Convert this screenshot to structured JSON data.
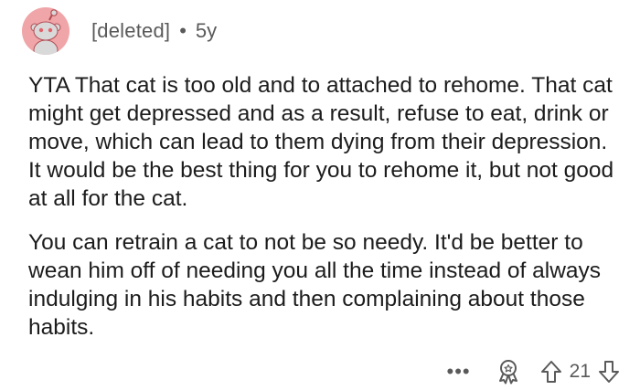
{
  "comment": {
    "author": "[deleted]",
    "separator": "•",
    "age": "5y",
    "paragraphs": [
      "YTA That cat is too old and to attached to rehome. That cat might get depressed and as a result, refuse to eat, drink or move, which can lead to them dying from their depression. It would be the best thing for you to rehome it, but not good at all for the cat.",
      "You can retrain a cat to not be so needy. It'd be better to wean him off of needing you all the time instead of always indulging in his habits and then complaining about those habits."
    ],
    "actions": {
      "more": "•••",
      "score": "21"
    }
  },
  "colors": {
    "avatar_bg": "#f0a5a8",
    "meta_text": "#5a5a5a",
    "body_text": "#1c1c1c"
  },
  "icons": [
    "snoo-avatar",
    "award-icon",
    "upvote-icon",
    "downvote-icon",
    "more-options-icon"
  ]
}
